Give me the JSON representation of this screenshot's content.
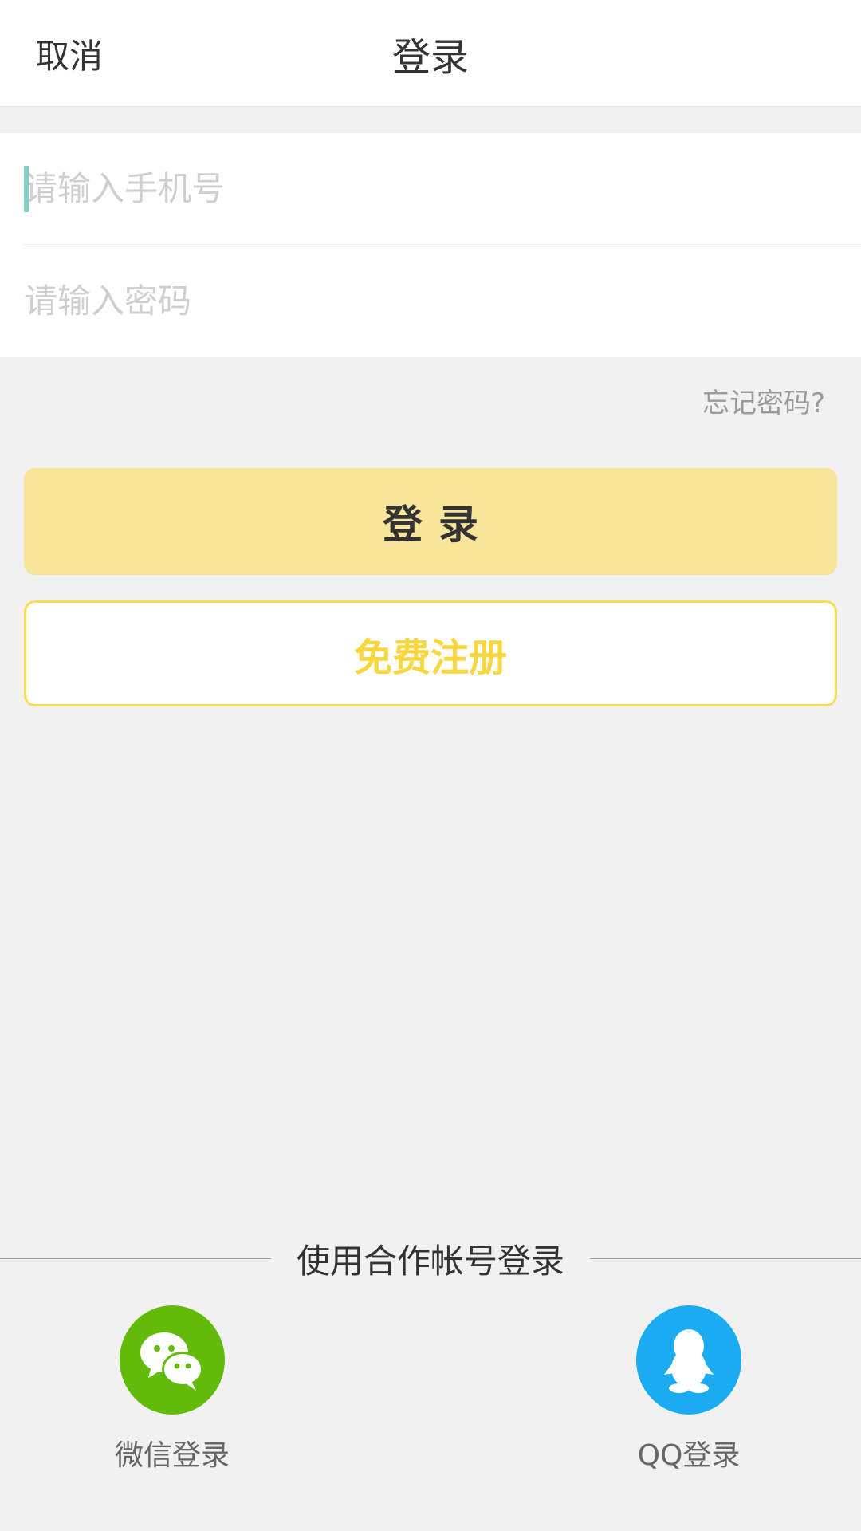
{
  "header": {
    "cancel_label": "取消",
    "title": "登录"
  },
  "form": {
    "phone_placeholder": "请输入手机号",
    "phone_value": "",
    "password_placeholder": "请输入密码",
    "password_value": ""
  },
  "forgot_password_label": "忘记密码?",
  "login_button_label": "登录",
  "register_button_label": "免费注册",
  "partner": {
    "divider_label": "使用合作帐号登录",
    "wechat": {
      "label": "微信登录",
      "icon": "wechat-icon",
      "color": "#62bb0a"
    },
    "qq": {
      "label": "QQ登录",
      "icon": "qq-penguin-icon",
      "color": "#1aabf2"
    }
  },
  "colors": {
    "login_button_bg": "#f8e59a",
    "register_accent": "#f7d63e",
    "caret": "#7fd1c7",
    "background": "#f1f1f1"
  }
}
